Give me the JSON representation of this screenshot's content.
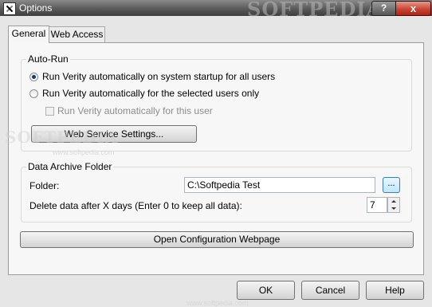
{
  "window": {
    "title": "Options",
    "watermark": "SOFTPEDIA",
    "help_glyph": "?",
    "close_glyph": "x"
  },
  "tabs": [
    {
      "label": "General",
      "selected": true
    },
    {
      "label": "Web Access",
      "selected": false
    }
  ],
  "autorun": {
    "title": "Auto-Run",
    "option_all_users": "Run Verity automatically on system startup for all users",
    "option_selected_users": "Run Verity automatically for the selected users only",
    "option_this_user": "Run Verity automatically for this user",
    "selected": "all_users",
    "this_user_checked": false,
    "web_service_button": "Web Service Settings..."
  },
  "archive": {
    "title": "Data Archive Folder",
    "folder_label": "Folder:",
    "folder_value": "C:\\Softpedia Test",
    "browse_label": "...",
    "delete_label": "Delete data after X days (Enter 0 to keep all data):",
    "days_value": "7"
  },
  "config_button": "Open Configuration Webpage",
  "footer": {
    "ok": "OK",
    "cancel": "Cancel",
    "help": "Help"
  },
  "watermarks": {
    "small_text": "www.softpedia.com",
    "overlay_text": "SOFTPEDIA"
  },
  "colors": {
    "title_bar": "#4f4f4f",
    "close_button": "#c9402c",
    "dialog_background": "#f7f7f7"
  }
}
